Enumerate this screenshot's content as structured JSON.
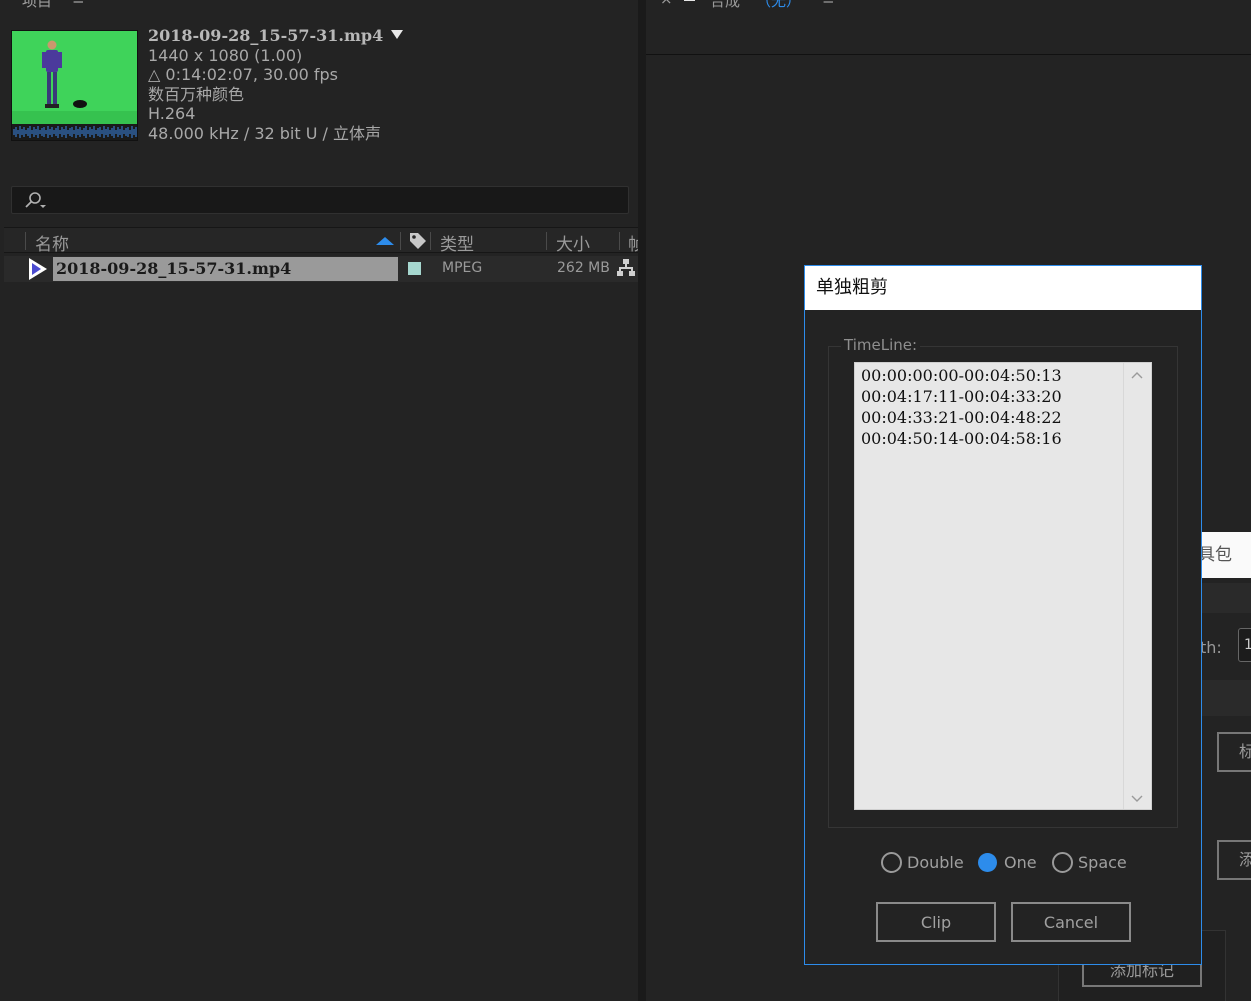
{
  "project_panel": {
    "title": "项目",
    "menu_glyph": "≡",
    "footage": {
      "name": "2018-09-28_15-57-31.mp4",
      "resolution": "1440 x 1080 (1.00)",
      "duration": "△ 0:14:02:07, 30.00 fps",
      "colors": "数百万种颜色",
      "codec": "H.264",
      "audio": "48.000 kHz / 32 bit U / 立体声"
    },
    "search": {
      "placeholder": ""
    },
    "columns": {
      "name": "名称",
      "type": "类型",
      "size": "大小",
      "extra": "帧"
    },
    "row": {
      "name": "2018-09-28_15-57-31.mp4",
      "type": "MPEG",
      "size": "262 MB",
      "label_color": "#a6d7cf"
    }
  },
  "comp_panel": {
    "close_glyph": "×",
    "tab_title": "合成",
    "tab_value": "（无）",
    "menu_glyph": "≡"
  },
  "background_panel": {
    "tab_fragment": "具包",
    "length_label_fragment": "th:",
    "length_value_fragment": "1",
    "button1_fragment": "标",
    "button2_fragment": "添",
    "add_marker_label": "添加标记"
  },
  "dialog": {
    "title": "单独粗剪",
    "group_label": "TimeLine:",
    "timeline_items": [
      "00:00:00:00-00:04:50:13",
      "00:04:17:11-00:04:33:20",
      "00:04:33:21-00:04:48:22",
      "00:04:50:14-00:04:58:16"
    ],
    "radio_options": [
      {
        "label": "Double",
        "selected": false
      },
      {
        "label": "One",
        "selected": true
      },
      {
        "label": "Space",
        "selected": false
      }
    ],
    "clip_label": "Clip",
    "cancel_label": "Cancel"
  },
  "colors": {
    "accent": "#2d8ceb",
    "panel_bg": "#232323",
    "list_bg": "#e7e7e7"
  }
}
